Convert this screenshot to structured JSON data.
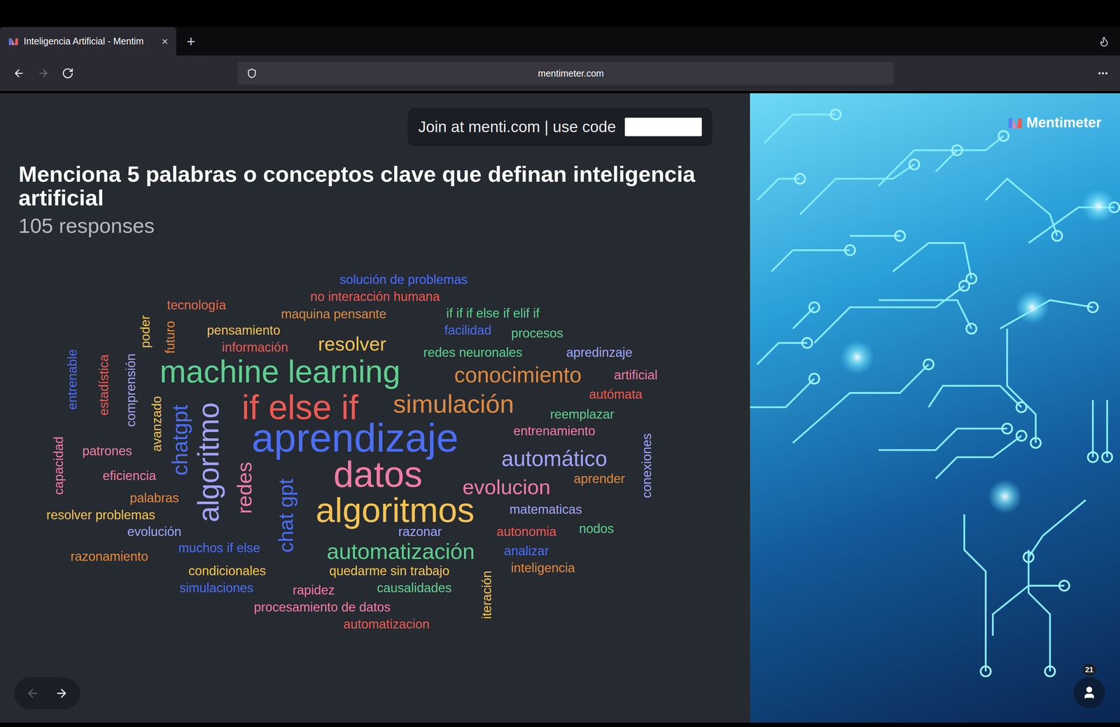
{
  "browser": {
    "tab": {
      "title": "Inteligencia Artificial - Mentim",
      "close": "×",
      "selected": true
    },
    "new_tab": "+",
    "url": "mentimeter.com",
    "nav": [
      {
        "kind": "back",
        "disabled": false
      },
      {
        "kind": "forward",
        "disabled": true
      },
      {
        "kind": "reload",
        "disabled": false
      }
    ]
  },
  "join": {
    "text": "Join at menti.com | use code"
  },
  "question": {
    "title": "Menciona 5 palabras o conceptos clave que definan inteligencia artificial",
    "responses": "105 responses"
  },
  "words": [
    {
      "text": "solución de problemas",
      "level": 0.32,
      "color": "#4b6ef5",
      "kind": "horizontal"
    },
    {
      "text": "no interacción humana",
      "level": 0.32,
      "color": "#ee5a52",
      "kind": "horizontal"
    },
    {
      "text": "tecnología",
      "level": 0.32,
      "color": "#ec6a48",
      "kind": "horizontal"
    },
    {
      "text": "maquina pensante",
      "level": 0.32,
      "color": "#df8a3f",
      "kind": "horizontal"
    },
    {
      "text": "if if if else if elif if",
      "level": 0.32,
      "color": "#5ed08f",
      "kind": "horizontal"
    },
    {
      "text": "poder",
      "level": 0.32,
      "color": "#f5c451",
      "kind": "vertical"
    },
    {
      "text": "futuro",
      "level": 0.32,
      "color": "#df8a3f",
      "kind": "vertical"
    },
    {
      "text": "pensamiento",
      "level": 0.32,
      "color": "#f5c451",
      "kind": "horizontal"
    },
    {
      "text": "facilidad",
      "level": 0.32,
      "color": "#4b6ef5",
      "kind": "horizontal"
    },
    {
      "text": "procesos",
      "level": 0.32,
      "color": "#5ed08f",
      "kind": "horizontal"
    },
    {
      "text": "información",
      "level": 0.32,
      "color": "#ee5a52",
      "kind": "horizontal"
    },
    {
      "text": "resolver",
      "level": 0.48,
      "color": "#f5c451",
      "kind": "horizontal"
    },
    {
      "text": "redes neuronales",
      "level": 0.32,
      "color": "#5ed08f",
      "kind": "horizontal"
    },
    {
      "text": "apredinzaje",
      "level": 0.32,
      "color": "#a2a5f6",
      "kind": "horizontal"
    },
    {
      "text": "entrenable",
      "level": 0.32,
      "color": "#4b6ef5",
      "kind": "vertical"
    },
    {
      "text": "estadística",
      "level": 0.32,
      "color": "#ee5a52",
      "kind": "vertical"
    },
    {
      "text": "comprensión",
      "level": 0.32,
      "color": "#a2a5f6",
      "kind": "vertical"
    },
    {
      "text": "machine learning",
      "level": 0.79,
      "color": "#5ed08f",
      "kind": "horizontal"
    },
    {
      "text": "conocimiento",
      "level": 0.54,
      "color": "#df8a3f",
      "kind": "horizontal"
    },
    {
      "text": "artificial",
      "level": 0.32,
      "color": "#f27ca6",
      "kind": "horizontal"
    },
    {
      "text": "autómata",
      "level": 0.32,
      "color": "#ee5a52",
      "kind": "horizontal"
    },
    {
      "text": "avanzado",
      "level": 0.32,
      "color": "#f5c451",
      "kind": "vertical"
    },
    {
      "text": "chatgpt",
      "level": 0.54,
      "color": "#4b6ef5",
      "kind": "vertical"
    },
    {
      "text": "algoritmo",
      "level": 0.73,
      "color": "#a2a5f6",
      "kind": "vertical"
    },
    {
      "text": "if else if",
      "level": 0.86,
      "color": "#ee5a52",
      "kind": "horizontal"
    },
    {
      "text": "simulación",
      "level": 0.64,
      "color": "#df8a3f",
      "kind": "horizontal"
    },
    {
      "text": "reemplazar",
      "level": 0.32,
      "color": "#5ed08f",
      "kind": "horizontal"
    },
    {
      "text": "entrenamiento",
      "level": 0.32,
      "color": "#f27ca6",
      "kind": "horizontal"
    },
    {
      "text": "capacidad",
      "level": 0.32,
      "color": "#f27ca6",
      "kind": "vertical"
    },
    {
      "text": "patrones",
      "level": 0.32,
      "color": "#f27ca6",
      "kind": "horizontal"
    },
    {
      "text": "aprendizaje",
      "level": 1,
      "color": "#4b6ef5",
      "kind": "horizontal"
    },
    {
      "text": "conexiones",
      "level": 0.32,
      "color": "#a2a5f6",
      "kind": "vertical"
    },
    {
      "text": "automático",
      "level": 0.54,
      "color": "#a2a5f6",
      "kind": "horizontal"
    },
    {
      "text": "redes",
      "level": 0.52,
      "color": "#f27ca6",
      "kind": "vertical"
    },
    {
      "text": "eficiencia",
      "level": 0.32,
      "color": "#f27ca6",
      "kind": "horizontal"
    },
    {
      "text": "datos",
      "level": 0.91,
      "color": "#f27ca6",
      "kind": "horizontal"
    },
    {
      "text": "evolucion",
      "level": 0.52,
      "color": "#f27ca6",
      "kind": "horizontal"
    },
    {
      "text": "aprender",
      "level": 0.32,
      "color": "#df8a3f",
      "kind": "horizontal"
    },
    {
      "text": "palabras",
      "level": 0.32,
      "color": "#df8a3f",
      "kind": "horizontal"
    },
    {
      "text": "chat gpt",
      "level": 0.52,
      "color": "#4b6ef5",
      "kind": "vertical"
    },
    {
      "text": "algoritmos",
      "level": 0.86,
      "color": "#f5c451",
      "kind": "horizontal"
    },
    {
      "text": "matematicas",
      "level": 0.32,
      "color": "#a2a5f6",
      "kind": "horizontal"
    },
    {
      "text": "resolver problemas",
      "level": 0.32,
      "color": "#f5c451",
      "kind": "horizontal"
    },
    {
      "text": "evolución",
      "level": 0.32,
      "color": "#a2a5f6",
      "kind": "horizontal"
    },
    {
      "text": "razonar",
      "level": 0.32,
      "color": "#a2a5f6",
      "kind": "horizontal"
    },
    {
      "text": "autonomia",
      "level": 0.32,
      "color": "#ee5a52",
      "kind": "horizontal"
    },
    {
      "text": "nodos",
      "level": 0.32,
      "color": "#5ed08f",
      "kind": "horizontal"
    },
    {
      "text": "razonamiento",
      "level": 0.32,
      "color": "#df8a3f",
      "kind": "horizontal"
    },
    {
      "text": "muchos if else",
      "level": 0.32,
      "color": "#4b6ef5",
      "kind": "horizontal"
    },
    {
      "text": "automatización",
      "level": 0.55,
      "color": "#5ed08f",
      "kind": "horizontal"
    },
    {
      "text": "analizar",
      "level": 0.32,
      "color": "#4b6ef5",
      "kind": "horizontal"
    },
    {
      "text": "condicionales",
      "level": 0.32,
      "color": "#f5c451",
      "kind": "horizontal"
    },
    {
      "text": "quedarme sin trabajo",
      "level": 0.32,
      "color": "#f5c451",
      "kind": "horizontal"
    },
    {
      "text": "inteligencia",
      "level": 0.32,
      "color": "#df8a3f",
      "kind": "horizontal"
    },
    {
      "text": "iteración",
      "level": 0.32,
      "color": "#f5c451",
      "kind": "vertical"
    },
    {
      "text": "simulaciones",
      "level": 0.32,
      "color": "#4b6ef5",
      "kind": "horizontal"
    },
    {
      "text": "rapidez",
      "level": 0.32,
      "color": "#f27ca6",
      "kind": "horizontal"
    },
    {
      "text": "causalidades",
      "level": 0.32,
      "color": "#5ed08f",
      "kind": "horizontal"
    },
    {
      "text": "procesamiento de datos",
      "level": 0.32,
      "color": "#f27ca6",
      "kind": "horizontal"
    },
    {
      "text": "automatizacion",
      "level": 0.32,
      "color": "#ee5a52",
      "kind": "horizontal"
    }
  ],
  "slide_nav": [
    {
      "kind": "previous",
      "disabled": true
    },
    {
      "kind": "next",
      "disabled": false
    }
  ],
  "brand": {
    "name": "Mentimeter"
  },
  "participants": {
    "count": "21"
  }
}
